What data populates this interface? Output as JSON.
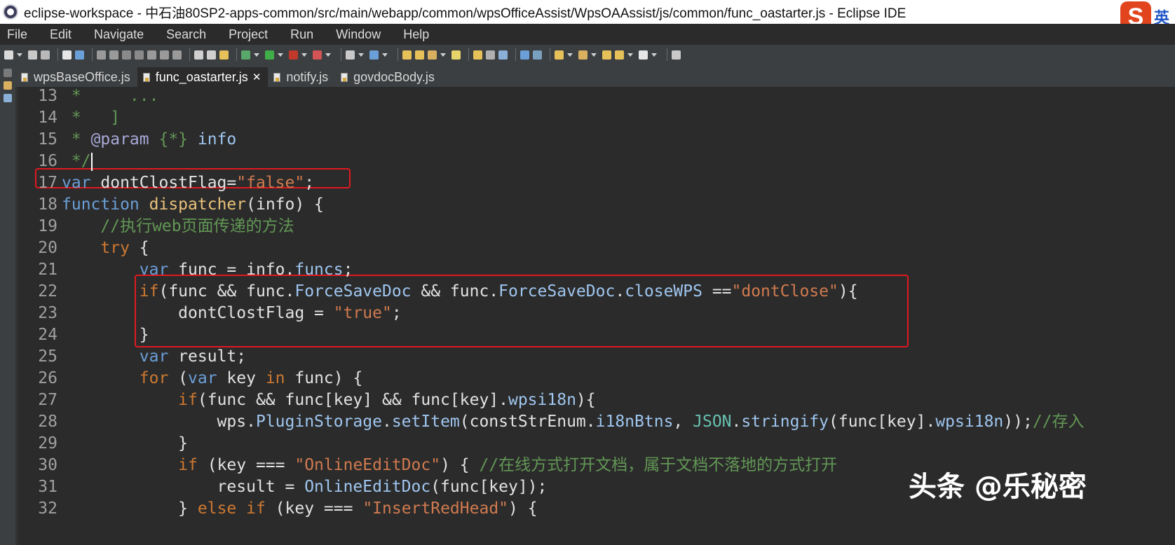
{
  "window": {
    "title": "eclipse-workspace - 中石油80SP2-apps-common/src/main/webapp/common/wpsOfficeAssist/WpsOAAssist/js/common/func_oastarter.js - Eclipse IDE"
  },
  "ime": {
    "logo": "S",
    "lang": "英"
  },
  "menu": [
    "File",
    "Edit",
    "Navigate",
    "Search",
    "Project",
    "Run",
    "Window",
    "Help"
  ],
  "tabs": [
    {
      "label": "wpsBaseOffice.js",
      "active": false
    },
    {
      "label": "func_oastarter.js",
      "active": true,
      "close": "✕"
    },
    {
      "label": "notify.js",
      "active": false
    },
    {
      "label": "govdocBody.js",
      "active": false
    }
  ],
  "code_lines": [
    {
      "num": "13",
      "parts": [
        {
          "t": " *     ...",
          "c": "cm"
        }
      ]
    },
    {
      "num": "14",
      "parts": [
        {
          "t": " *   ]",
          "c": "cm"
        }
      ]
    },
    {
      "num": "15",
      "parts": [
        {
          "t": " * ",
          "c": "cm"
        },
        {
          "t": "@param",
          "c": "tag"
        },
        {
          "t": " {*} ",
          "c": "cm"
        },
        {
          "t": "info",
          "c": "mem"
        }
      ]
    },
    {
      "num": "16",
      "parts": [
        {
          "t": " */",
          "c": "cm"
        }
      ],
      "caret": true
    },
    {
      "num": "17",
      "parts": [
        {
          "t": "var",
          "c": "kwb"
        },
        {
          "t": " dontClostFlag=",
          "c": ""
        },
        {
          "t": "\"false\"",
          "c": "str"
        },
        {
          "t": ";",
          "c": ""
        }
      ]
    },
    {
      "num": "18",
      "parts": [
        {
          "t": "function",
          "c": "kwb"
        },
        {
          "t": " ",
          "c": ""
        },
        {
          "t": "dispatcher",
          "c": "fn"
        },
        {
          "t": "(info) {",
          "c": ""
        }
      ]
    },
    {
      "num": "19",
      "parts": [
        {
          "t": "    //执行web页面传递的方法",
          "c": "cm"
        }
      ]
    },
    {
      "num": "20",
      "parts": [
        {
          "t": "    ",
          "c": ""
        },
        {
          "t": "try",
          "c": "kw"
        },
        {
          "t": " {",
          "c": ""
        }
      ]
    },
    {
      "num": "21",
      "parts": [
        {
          "t": "        ",
          "c": ""
        },
        {
          "t": "var",
          "c": "kwb"
        },
        {
          "t": " func = info.",
          "c": ""
        },
        {
          "t": "funcs",
          "c": "mem"
        },
        {
          "t": ";",
          "c": ""
        }
      ]
    },
    {
      "num": "22",
      "parts": [
        {
          "t": "        ",
          "c": ""
        },
        {
          "t": "if",
          "c": "kw"
        },
        {
          "t": "(func && func.",
          "c": ""
        },
        {
          "t": "ForceSaveDoc",
          "c": "mem"
        },
        {
          "t": " && func.",
          "c": ""
        },
        {
          "t": "ForceSaveDoc",
          "c": "mem"
        },
        {
          "t": ".",
          "c": ""
        },
        {
          "t": "closeWPS",
          "c": "mem"
        },
        {
          "t": " ==",
          "c": ""
        },
        {
          "t": "\"dontClose\"",
          "c": "str"
        },
        {
          "t": "){",
          "c": ""
        }
      ]
    },
    {
      "num": "23",
      "parts": [
        {
          "t": "            dontClostFlag = ",
          "c": ""
        },
        {
          "t": "\"true\"",
          "c": "str"
        },
        {
          "t": ";",
          "c": ""
        }
      ]
    },
    {
      "num": "24",
      "parts": [
        {
          "t": "        }",
          "c": ""
        }
      ]
    },
    {
      "num": "25",
      "parts": [
        {
          "t": "        ",
          "c": ""
        },
        {
          "t": "var",
          "c": "kwb"
        },
        {
          "t": " result;",
          "c": ""
        }
      ]
    },
    {
      "num": "26",
      "parts": [
        {
          "t": "        ",
          "c": ""
        },
        {
          "t": "for",
          "c": "kw"
        },
        {
          "t": " (",
          "c": ""
        },
        {
          "t": "var",
          "c": "kwb"
        },
        {
          "t": " key ",
          "c": ""
        },
        {
          "t": "in",
          "c": "kw"
        },
        {
          "t": " func) {",
          "c": ""
        }
      ]
    },
    {
      "num": "27",
      "parts": [
        {
          "t": "            ",
          "c": ""
        },
        {
          "t": "if",
          "c": "kw"
        },
        {
          "t": "(func && func[key] && func[key].",
          "c": ""
        },
        {
          "t": "wpsi18n",
          "c": "mem"
        },
        {
          "t": "){",
          "c": ""
        }
      ]
    },
    {
      "num": "28",
      "parts": [
        {
          "t": "                wps.",
          "c": ""
        },
        {
          "t": "PluginStorage",
          "c": "mem"
        },
        {
          "t": ".",
          "c": ""
        },
        {
          "t": "setItem",
          "c": "mem"
        },
        {
          "t": "(constStrEnum.",
          "c": ""
        },
        {
          "t": "i18nBtns",
          "c": "mem"
        },
        {
          "t": ", ",
          "c": ""
        },
        {
          "t": "JSON",
          "c": "cls"
        },
        {
          "t": ".",
          "c": ""
        },
        {
          "t": "stringify",
          "c": "mem"
        },
        {
          "t": "(func[key].",
          "c": ""
        },
        {
          "t": "wpsi18n",
          "c": "mem"
        },
        {
          "t": "));",
          "c": ""
        },
        {
          "t": "//存入",
          "c": "cm"
        }
      ]
    },
    {
      "num": "29",
      "parts": [
        {
          "t": "            }",
          "c": ""
        }
      ]
    },
    {
      "num": "30",
      "parts": [
        {
          "t": "            ",
          "c": ""
        },
        {
          "t": "if",
          "c": "kw"
        },
        {
          "t": " (key === ",
          "c": ""
        },
        {
          "t": "\"OnlineEditDoc\"",
          "c": "str"
        },
        {
          "t": ") { ",
          "c": ""
        },
        {
          "t": "//在线方式打开文档，属于文档不落地的方式打开",
          "c": "cm"
        }
      ]
    },
    {
      "num": "31",
      "parts": [
        {
          "t": "                result = ",
          "c": ""
        },
        {
          "t": "OnlineEditDoc",
          "c": "mem"
        },
        {
          "t": "(func[key]);",
          "c": ""
        }
      ]
    },
    {
      "num": "32",
      "parts": [
        {
          "t": "            } ",
          "c": ""
        },
        {
          "t": "else",
          "c": "kw"
        },
        {
          "t": " ",
          "c": ""
        },
        {
          "t": "if",
          "c": "kw"
        },
        {
          "t": " (key === ",
          "c": ""
        },
        {
          "t": "\"InsertRedHead\"",
          "c": "str"
        },
        {
          "t": ") {",
          "c": ""
        }
      ]
    }
  ],
  "watermark": "头条 @乐秘密",
  "colors": {
    "highlight_box": "#e0191f",
    "editor_bg": "#2b2b2b"
  }
}
